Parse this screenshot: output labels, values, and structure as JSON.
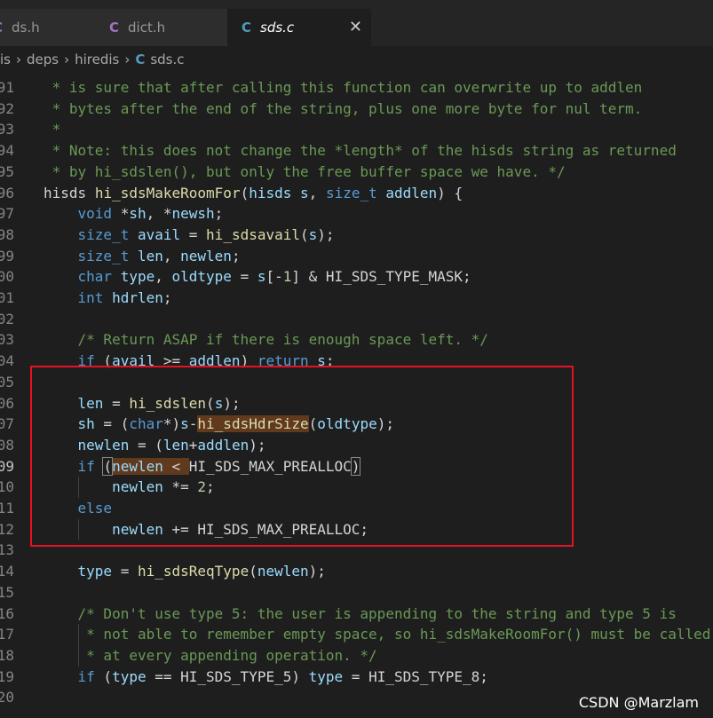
{
  "tabs": [
    {
      "icon": "C",
      "label": "ds.h",
      "active": false
    },
    {
      "icon": "C",
      "label": "dict.h",
      "active": false
    },
    {
      "icon": "C",
      "label": "sds.c",
      "active": true,
      "close": "✕"
    }
  ],
  "breadcrumb": [
    "is",
    "deps",
    "hiredis",
    "sds.c"
  ],
  "breadcrumb_sep": "›",
  "watermark": "CSDN @Marzlam",
  "lines": [
    {
      "n": "91",
      "t": " * is sure that after calling this function can overwrite up to addlen"
    },
    {
      "n": "92",
      "t": " * bytes after the end of the string, plus one more byte for nul term."
    },
    {
      "n": "93",
      "t": " *"
    },
    {
      "n": "94",
      "t": " * Note: this does not change the *length* of the hisds string as returned"
    },
    {
      "n": "95",
      "t": " * by hi_sdslen(), but only the free buffer space we have. */"
    },
    {
      "n": "96",
      "t": "hisds hi_sdsMakeRoomFor(hisds s, size_t addlen) {"
    },
    {
      "n": "97",
      "t": "    void *sh, *newsh;"
    },
    {
      "n": "98",
      "t": "    size_t avail = hi_sdsavail(s);"
    },
    {
      "n": "99",
      "t": "    size_t len, newlen;"
    },
    {
      "n": "00",
      "t": "    char type, oldtype = s[-1] & HI_SDS_TYPE_MASK;"
    },
    {
      "n": "01",
      "t": "    int hdrlen;"
    },
    {
      "n": "02",
      "t": ""
    },
    {
      "n": "03",
      "t": "    /* Return ASAP if there is enough space left. */"
    },
    {
      "n": "04",
      "t": "    if (avail >= addlen) return s;"
    },
    {
      "n": "05",
      "t": ""
    },
    {
      "n": "06",
      "t": "    len = hi_sdslen(s);"
    },
    {
      "n": "07",
      "t": "    sh = (char*)s-hi_sdsHdrSize(oldtype);"
    },
    {
      "n": "08",
      "t": "    newlen = (len+addlen);"
    },
    {
      "n": "09",
      "t": "    if (newlen < HI_SDS_MAX_PREALLOC)"
    },
    {
      "n": "10",
      "t": "        newlen *= 2;"
    },
    {
      "n": "11",
      "t": "    else"
    },
    {
      "n": "12",
      "t": "        newlen += HI_SDS_MAX_PREALLOC;"
    },
    {
      "n": "13",
      "t": ""
    },
    {
      "n": "14",
      "t": "    type = hi_sdsReqType(newlen);"
    },
    {
      "n": "15",
      "t": ""
    },
    {
      "n": "16",
      "t": "    /* Don't use type 5: the user is appending to the string and type 5 is"
    },
    {
      "n": "17",
      "t": "     * not able to remember empty space, so hi_sdsMakeRoomFor() must be called"
    },
    {
      "n": "18",
      "t": "     * at every appending operation. */"
    },
    {
      "n": "19",
      "t": "    if (type == HI_SDS_TYPE_5) type = HI_SDS_TYPE_8;"
    },
    {
      "n": "20",
      "t": ""
    }
  ]
}
